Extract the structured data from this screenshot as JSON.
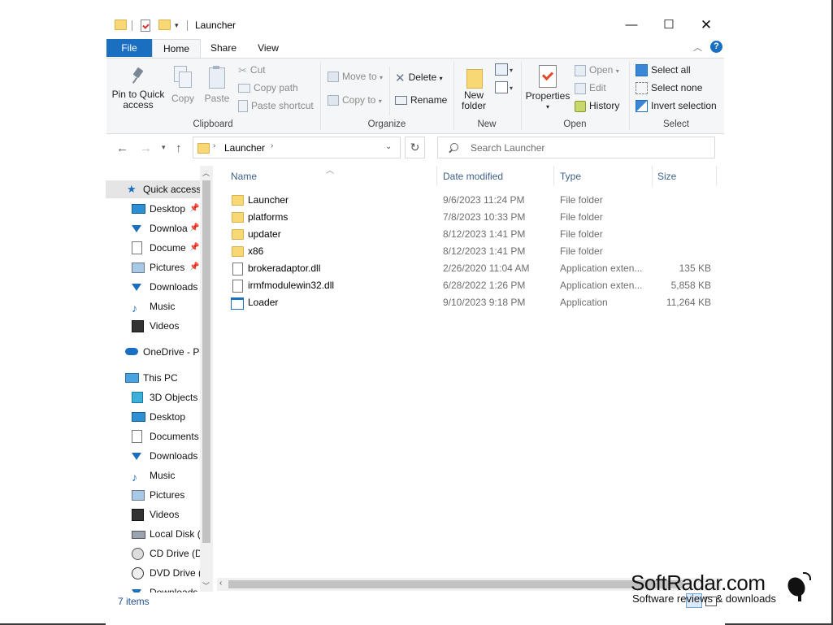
{
  "window": {
    "title": "Launcher"
  },
  "tabs": [
    "File",
    "Home",
    "Share",
    "View"
  ],
  "ribbon": {
    "clipboard": {
      "label": "Clipboard",
      "pin": "Pin to Quick",
      "pin2": "access",
      "copy": "Copy",
      "paste": "Paste",
      "cut": "Cut",
      "copy_path": "Copy path",
      "paste_shortcut": "Paste shortcut"
    },
    "organize": {
      "label": "Organize",
      "move_to": "Move to",
      "copy_to": "Copy to",
      "delete": "Delete",
      "rename": "Rename"
    },
    "new": {
      "label": "New",
      "new_folder": "New",
      "new_folder2": "folder"
    },
    "open": {
      "label": "Open",
      "properties": "Properties",
      "open": "Open",
      "edit": "Edit",
      "history": "History"
    },
    "select": {
      "label": "Select",
      "select_all": "Select all",
      "select_none": "Select none",
      "invert": "Invert selection"
    }
  },
  "address": {
    "path": "Launcher",
    "search_placeholder": "Search Launcher"
  },
  "nav": {
    "quick_access": "Quick access",
    "quick_items": [
      "Desktop",
      "Downloa",
      "Docume",
      "Pictures",
      "Downloads",
      "Music",
      "Videos"
    ],
    "onedrive": "OneDrive - Pe",
    "this_pc": "This PC",
    "pc_items": [
      "3D Objects",
      "Desktop",
      "Documents",
      "Downloads",
      "Music",
      "Pictures",
      "Videos",
      "Local Disk (",
      "CD Drive (D",
      "DVD Drive (I",
      "Downloads"
    ]
  },
  "columns": {
    "name": "Name",
    "date": "Date modified",
    "type": "Type",
    "size": "Size"
  },
  "files": [
    {
      "name": "Launcher",
      "date": "9/6/2023 11:24 PM",
      "type": "File folder",
      "size": "",
      "icon": "folder-icon"
    },
    {
      "name": "platforms",
      "date": "7/8/2023 10:33 PM",
      "type": "File folder",
      "size": "",
      "icon": "folder-icon"
    },
    {
      "name": "updater",
      "date": "8/12/2023 1:41 PM",
      "type": "File folder",
      "size": "",
      "icon": "folder-icon"
    },
    {
      "name": "x86",
      "date": "8/12/2023 1:41 PM",
      "type": "File folder",
      "size": "",
      "icon": "folder-icon"
    },
    {
      "name": "brokeradaptor.dll",
      "date": "2/26/2020 11:04 AM",
      "type": "Application exten...",
      "size": "135 KB",
      "icon": "dll-icon"
    },
    {
      "name": "irmfmodulewin32.dll",
      "date": "6/28/2022 1:26 PM",
      "type": "Application exten...",
      "size": "5,858 KB",
      "icon": "dll-icon"
    },
    {
      "name": "Loader",
      "date": "9/10/2023 9:18 PM",
      "type": "Application",
      "size": "11,264 KB",
      "icon": "app-icon"
    }
  ],
  "status": {
    "count": "7 items"
  },
  "watermark": {
    "brand": "SoftRadar.com",
    "tagline": "Software reviews & downloads"
  },
  "colors": {
    "accent": "#1a6fc1",
    "folder": "#f8d775",
    "selection": "#e5e5e5"
  }
}
